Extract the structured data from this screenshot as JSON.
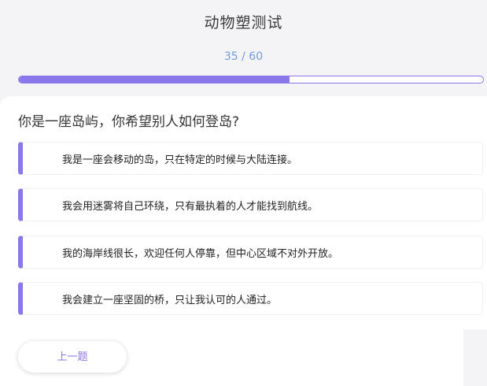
{
  "header": {
    "title": "动物塑测试",
    "progress_text": "35 / 60",
    "progress_fraction": 0.5833
  },
  "question": {
    "text": "你是一座岛屿，你希望别人如何登岛?"
  },
  "options": [
    {
      "label": "我是一座会移动的岛，只在特定的时候与大陆连接。"
    },
    {
      "label": "我会用迷雾将自己环绕，只有最执着的人才能找到航线。"
    },
    {
      "label": "我的海岸线很长，欢迎任何人停靠，但中心区域不对外开放。"
    },
    {
      "label": "我会建立一座坚固的桥，只让我认可的人通过。"
    }
  ],
  "nav": {
    "prev_label": "上一题"
  },
  "colors": {
    "accent": "#8a78ea",
    "progress_text": "#6f9be0"
  }
}
